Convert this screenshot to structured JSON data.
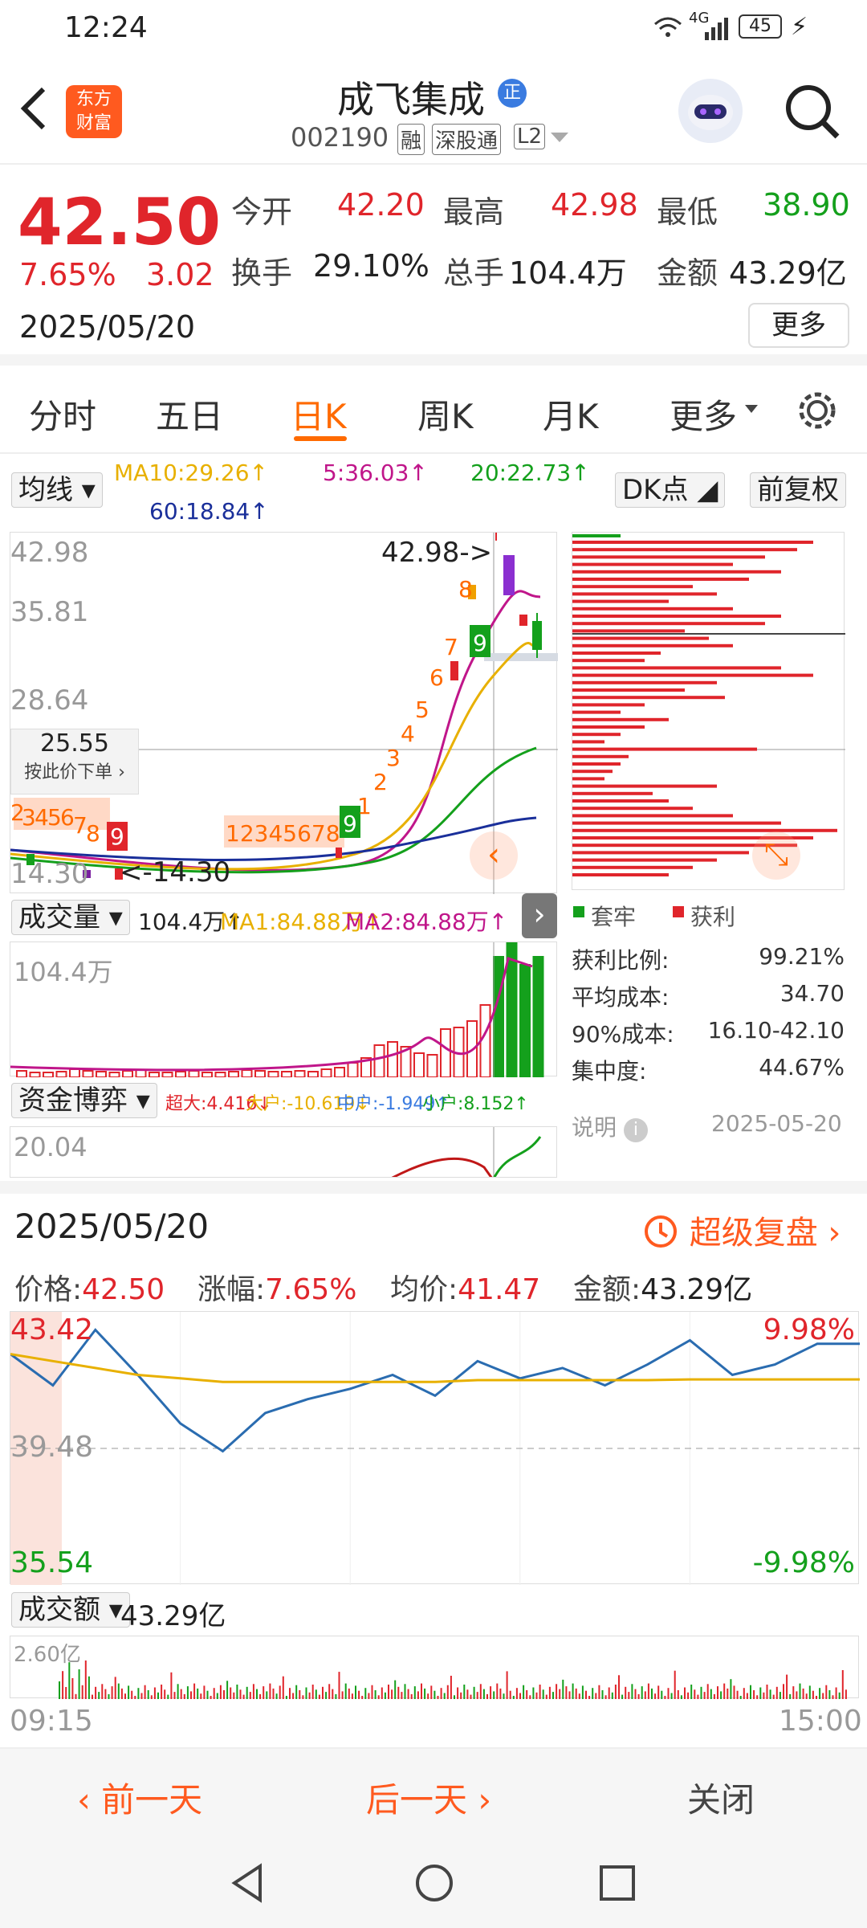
{
  "status": {
    "time": "12:24",
    "battery": "45",
    "signal": "4G"
  },
  "header": {
    "title": "成飞集成",
    "title_badge": "正",
    "code": "002190",
    "tags": [
      "融",
      "深股通",
      "L2"
    ],
    "logo_line1": "东方",
    "logo_line2": "财富"
  },
  "quote": {
    "price": "42.50",
    "pct": "7.65%",
    "change": "3.02",
    "date": "2025/05/20",
    "open_label": "今开",
    "open": "42.20",
    "high_label": "最高",
    "high": "42.98",
    "low_label": "最低",
    "low": "38.90",
    "turnover_label": "换手",
    "turnover": "29.10%",
    "vol_label": "总手",
    "vol": "104.4万",
    "amount_label": "金额",
    "amount": "43.29亿",
    "more": "更多"
  },
  "tabs": [
    "分时",
    "五日",
    "日K",
    "周K",
    "月K",
    "更多"
  ],
  "kline": {
    "ma_select": "均线",
    "ma10": "MA10:29.26↑",
    "ma5": "5:36.03↑",
    "ma20": "20:22.73↑",
    "ma60": "60:18.84↑",
    "dk": "DK点",
    "fq": "前复权",
    "price_labels": [
      "42.98",
      "35.81",
      "28.64",
      "14.30"
    ],
    "cursor_price": "25.55",
    "cursor_hint": "按此价下单",
    "max_label": "42.98->",
    "min_label": "<-14.30",
    "seq_left": [
      "2",
      "3",
      "4",
      "5",
      "6",
      "7",
      "8"
    ],
    "seq_mid": "12345678",
    "seq_up": [
      "1",
      "2",
      "3",
      "4",
      "5",
      "6",
      "7",
      "8"
    ],
    "nine": "9"
  },
  "volume": {
    "select": "成交量",
    "val": "104.4万↑",
    "ma1": "MA1:84.88万↑",
    "ma2": "MA2:84.88万↑",
    "max": "104.4万"
  },
  "fund": {
    "select": "资金博弈",
    "super": "超大:4.416↓",
    "big": "大户:-10.619↓",
    "mid": "中户:-1.949↑",
    "small": "小户:8.152↑",
    "max": "20.04"
  },
  "chip": {
    "legend_trap": "套牢",
    "legend_profit": "获利",
    "rows": [
      {
        "k": "获利比例:",
        "v": "99.21%"
      },
      {
        "k": "平均成本:",
        "v": "34.70"
      },
      {
        "k": "90%成本:",
        "v": "16.10-42.10"
      },
      {
        "k": "集中度:",
        "v": "44.67%"
      }
    ],
    "note": "说明",
    "date": "2025-05-20"
  },
  "review": {
    "date": "2025/05/20",
    "btn": "超级复盘",
    "price_k": "价格:",
    "price_v": "42.50",
    "pct_k": "涨幅:",
    "pct_v": "7.65%",
    "avg_k": "均价:",
    "avg_v": "41.47",
    "amt_k": "金额:",
    "amt_v": "43.29亿",
    "y_top": "43.42",
    "y_mid": "39.48",
    "y_bot": "35.54",
    "pct_top": "9.98%",
    "pct_bot": "-9.98%",
    "amt_select": "成交额",
    "amt_total": "43.29亿",
    "amt_max": "2.60亿",
    "t_start": "09:15",
    "t_end": "15:00"
  },
  "bottom": {
    "prev": "前一天",
    "next": "后一天",
    "close": "关闭"
  },
  "colors": {
    "up": "#e0252b",
    "down": "#14a01c",
    "accent": "#ff6a00"
  },
  "chart_data": {
    "type": "line",
    "title": "",
    "x": [
      "09:15",
      "15:00"
    ],
    "ylim": [
      35.54,
      43.42
    ],
    "series": [
      {
        "name": "价格",
        "values": [
          42.2,
          41.3,
          42.9,
          41.6,
          40.2,
          39.4,
          40.5,
          40.9,
          41.2,
          41.6,
          41.0,
          42.0,
          41.5,
          41.8,
          41.3,
          41.9,
          42.6,
          41.6,
          41.9,
          42.5,
          42.5
        ]
      },
      {
        "name": "均价",
        "values": [
          42.2,
          42.0,
          41.8,
          41.6,
          41.5,
          41.4,
          41.4,
          41.4,
          41.4,
          41.4,
          41.4,
          41.45,
          41.45,
          41.45,
          41.45,
          41.45,
          41.47,
          41.47,
          41.47,
          41.47,
          41.47
        ]
      }
    ]
  }
}
